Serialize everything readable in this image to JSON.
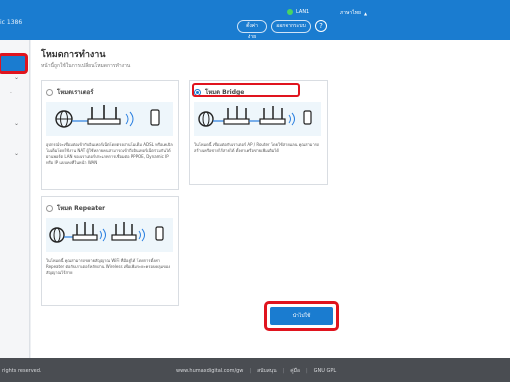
{
  "header": {
    "left_text": "ic 1386",
    "status_label": "LAN1",
    "language": "ภาษาไทย",
    "settings_label": "ตั้งค่าง่าย",
    "logout_label": "ออกจากระบบ",
    "help_symbol": "?"
  },
  "page": {
    "title": "โหมดการทำงาน",
    "subtitle": "หน้านี้ถูกใช้ในการเปลี่ยนโหมดการทำงาน"
  },
  "modes": [
    {
      "label": "โหมดเราเตอร์",
      "selected": false,
      "description": "อุปกรณ์จะเชื่อมต่อเข้ากับอินเทอร์เน็ตโดยตรงผ่านโมเด็ม ADSL หรือเคเบิลโมเด็มโดยใช้งาน NAT ผู้ใช้หลายคนสามารถเข้าถึงอินเทอร์เน็ตร่วมกันได้ผ่านพอร์ต LAN ของเราเตอร์ประเภทการเชื่อมต่อ PPPOE, Dynamic IP หรือ IP แบบคงที่ในหน้า WAN"
    },
    {
      "label": "โหมด Bridge",
      "selected": true,
      "description": "ในโหมดนี้ เชื่อมต่อกับเราเตอร์ AP / Router โดยใช้สายแลน คุณสามารถสร้างเครือข่ายไร้สายได้ ตั้งค่าเครือข่ายเพิ่มเติมได้"
    },
    {
      "label": "โหมด Repeater",
      "selected": false,
      "description": "ในโหมดนี้ คุณสามารถขยายสัญญาณ WiFi ที่มีอยู่ได้ โดยการตั้งค่า Repeater ต่อกับเราเตอร์หลักผ่าน Wireless เพื่อเพิ่มระยะครอบคลุมของสัญญาณไร้สาย"
    }
  ],
  "apply_label": "นำไปใช้",
  "footer": {
    "left": "rights reserved.",
    "links": [
      "www.humaxdigital.com/gw",
      "สนับสนุน",
      "คู่มือ",
      "GNU GPL"
    ]
  },
  "colors": {
    "brand": "#1a7cd0",
    "highlight": "#e0141e"
  }
}
